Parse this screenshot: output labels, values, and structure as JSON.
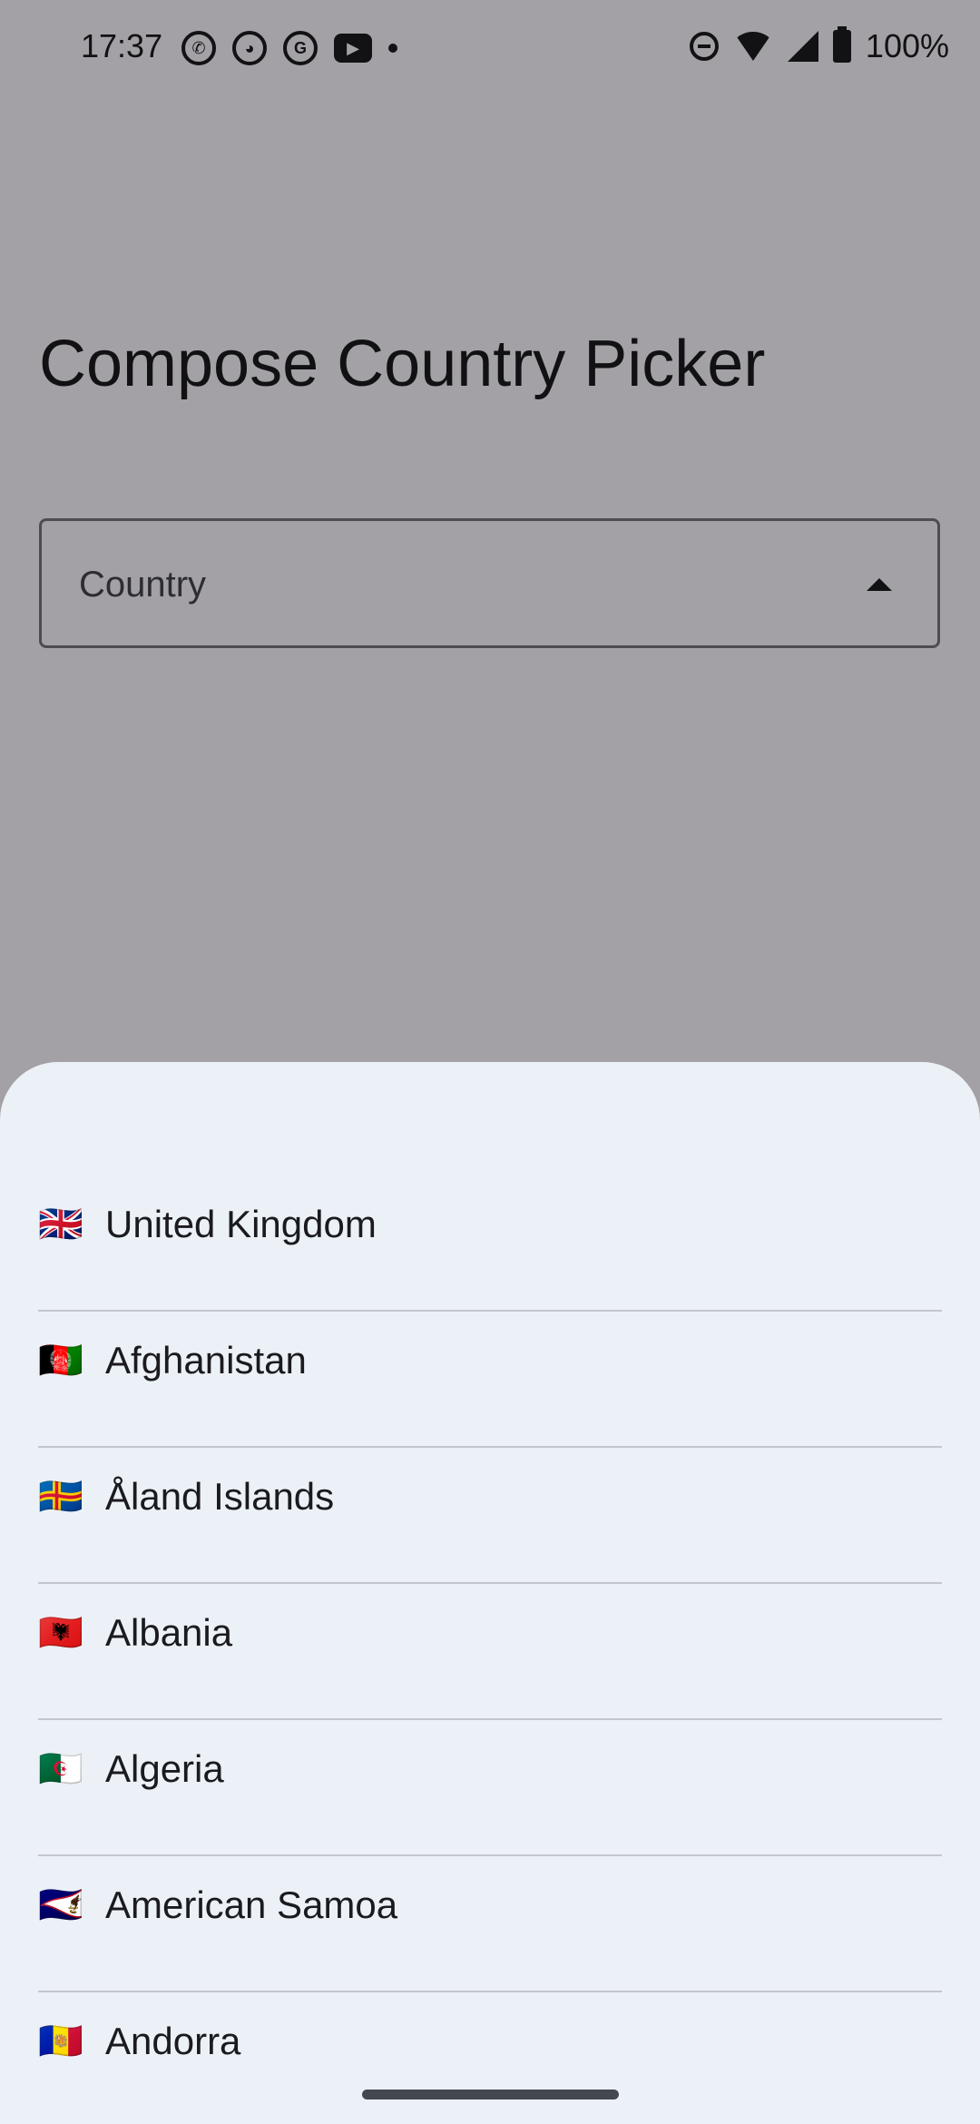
{
  "status_bar": {
    "time": "17:37",
    "battery": "100%",
    "left_icons": [
      "whatsapp-icon",
      "github-icon",
      "google-icon",
      "youtube-icon"
    ],
    "right_icons": [
      "dnd-icon",
      "wifi-icon",
      "signal-icon",
      "battery-icon"
    ]
  },
  "main": {
    "title": "Compose Country Picker",
    "country_field": {
      "label": "Country",
      "icon": "arrow-drop-up-icon"
    }
  },
  "sheet": {
    "countries": [
      {
        "flag": "🇬🇧",
        "name": "United Kingdom"
      },
      {
        "flag": "🇦🇫",
        "name": "Afghanistan"
      },
      {
        "flag": "🇦🇽",
        "name": "Åland Islands"
      },
      {
        "flag": "🇦🇱",
        "name": "Albania"
      },
      {
        "flag": "🇩🇿",
        "name": "Algeria"
      },
      {
        "flag": "🇦🇸",
        "name": "American Samoa"
      },
      {
        "flag": "🇦🇩",
        "name": "Andorra"
      }
    ]
  },
  "colors": {
    "sheet_background": "#ecf1f8",
    "divider": "#c4c6cf",
    "text": "#1b1b1f",
    "outline": "#77767c"
  }
}
